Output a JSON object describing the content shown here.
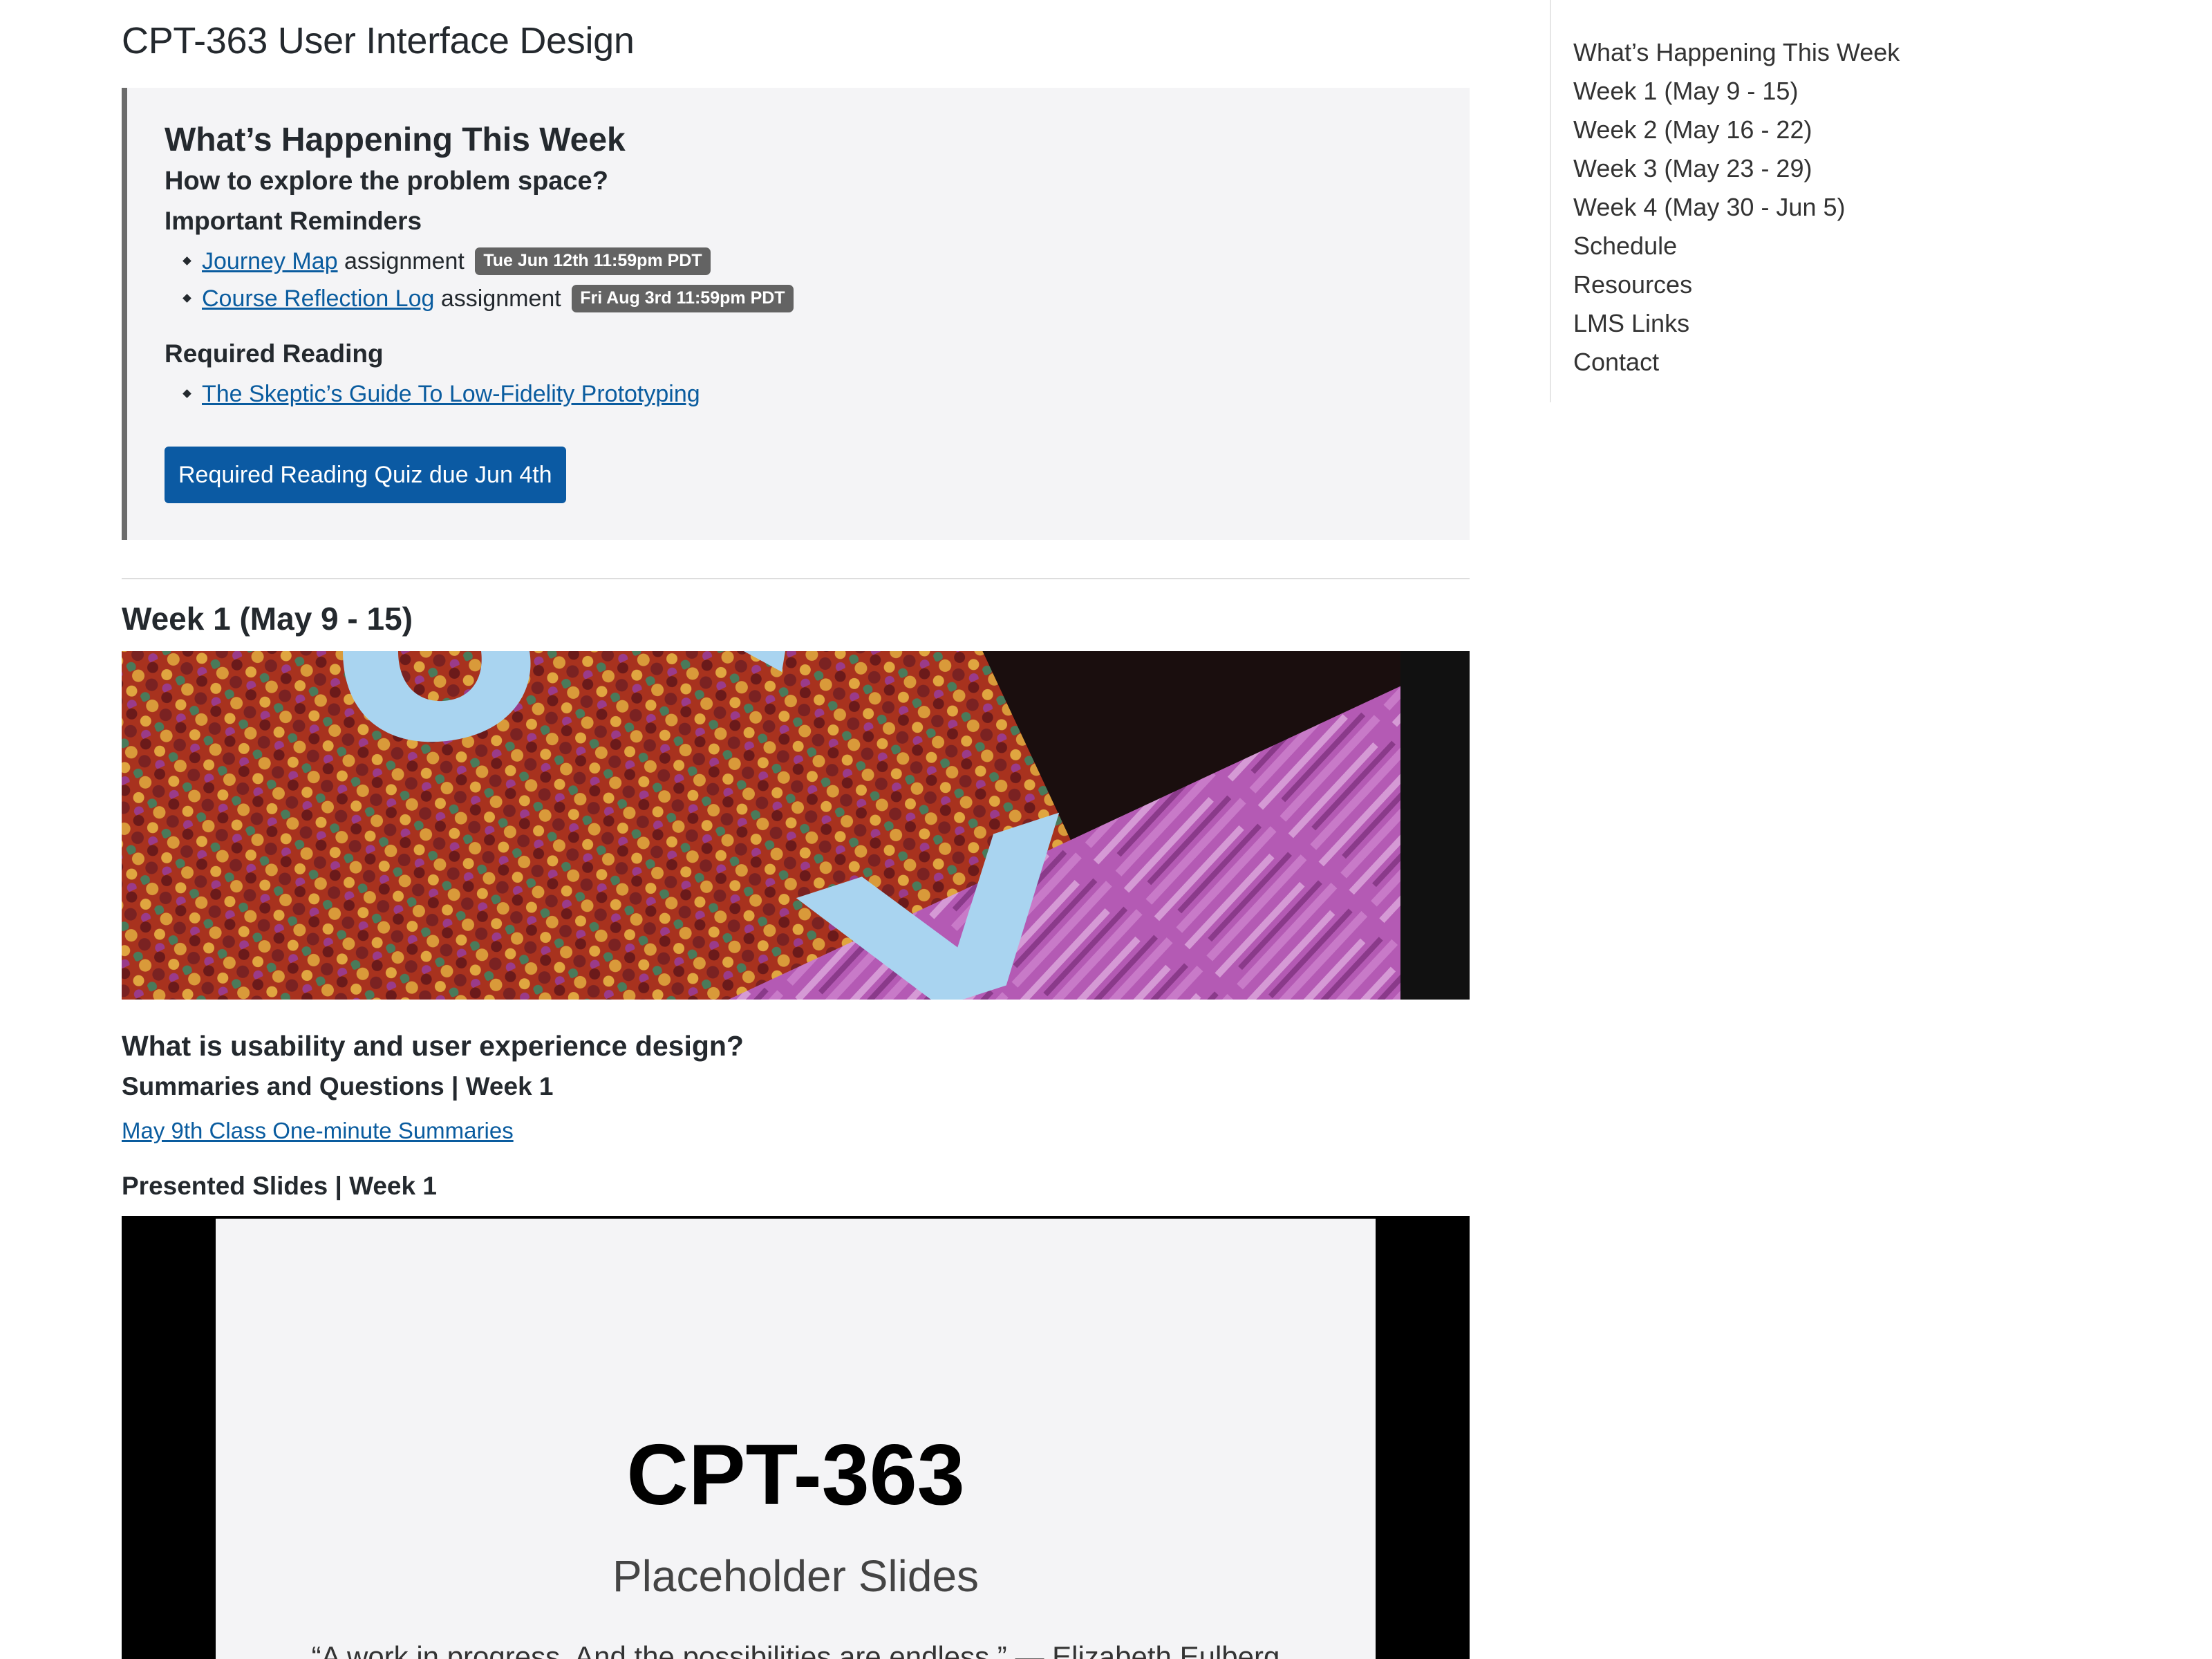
{
  "site": {
    "title": "CPT-363 User Interface Design"
  },
  "announcement": {
    "title": "What’s Happening This Week",
    "subtitle": "How to explore the problem space?",
    "reminders_heading": "Important Reminders",
    "reminders": [
      {
        "link": "Journey Map",
        "suffix": " assignment",
        "due": "Tue Jun 12th 11:59pm PDT"
      },
      {
        "link": "Course Reflection Log",
        "suffix": " assignment",
        "due": "Fri Aug 3rd 11:59pm PDT"
      }
    ],
    "reading_heading": "Required Reading",
    "readings": [
      {
        "link": "The Skeptic’s Guide To Low-Fidelity Prototyping"
      }
    ],
    "quiz_button": "Required Reading Quiz due Jun 4th"
  },
  "week1": {
    "title": "Week 1 (May 9 - 15)",
    "question": "What is usability and user experience design?",
    "summaries_heading": "Summaries and Questions | Week 1",
    "summaries_link": "May 9th Class One-minute Summaries",
    "slides_heading": "Presented Slides | Week 1",
    "slide": {
      "title": "CPT-363",
      "subtitle": "Placeholder Slides",
      "quote": "“A work in progress. And the possibilities are endless.” — Elizabeth Eulberg"
    }
  },
  "sidebar": {
    "items": [
      "What’s Happening This Week",
      "Week 1 (May 9 - 15)",
      "Week 2 (May 16 - 22)",
      "Week 3 (May 23 - 29)",
      "Week 4 (May 30 - Jun 5)",
      "Schedule",
      "Resources",
      "LMS Links",
      "Contact"
    ]
  },
  "colors": {
    "link": "#0a5c9f",
    "button": "#0b5aa3",
    "badge": "#636363",
    "announcement_bg": "#f4f4f6",
    "announcement_border": "#6b6b6b"
  }
}
